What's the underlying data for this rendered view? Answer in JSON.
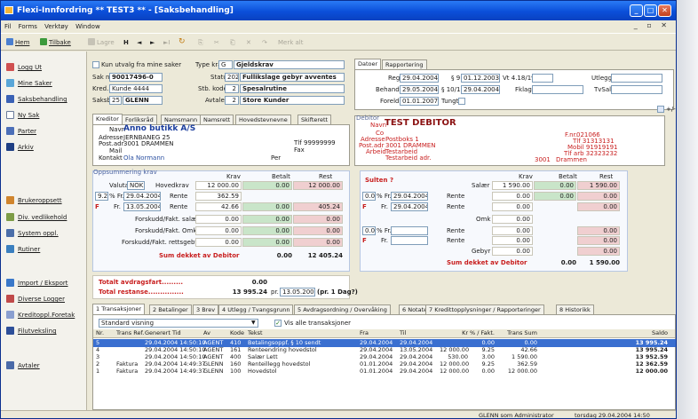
{
  "window": {
    "title": "Flexi-Innfordring ** TEST3 **   - [Saksbehandling]"
  },
  "menu": [
    "Fil",
    "Forms",
    "Verktøy",
    "Window"
  ],
  "toolbar": {
    "home": "Hem",
    "back": "Tilbake",
    "save": "Lagre",
    "first": "H",
    "prev": "◄",
    "next": "►",
    "last": "►I",
    "refresh": "↻",
    "copy": "⎘",
    "cut": "✂",
    "paste": "⎗",
    "delete": "✕",
    "redo": "↷",
    "report": "Merk alt"
  },
  "sidebar": {
    "items": [
      "Logg Ut",
      "Mine Saker",
      "Saksbehandling",
      "Ny Sak",
      "Parter",
      "Arkiv",
      "Brukeroppsett",
      "Div. vedlikehold",
      "System oppl.",
      "Rutiner",
      "Import / Eksport",
      "Diverse Logger",
      "Kreditoppl.Foretak",
      "Filutveksling",
      "Avtaler"
    ]
  },
  "case": {
    "only_mine_label": "Kun utvalg fra mine saker",
    "type_label": "Type krav",
    "type_code": "G",
    "type_name": "Gjeldskrav",
    "saknr_label": "Sak nr",
    "saknr": "90017496-0",
    "status_label": "Status",
    "status_code": "202",
    "status_text": "Fullikslage gebyr avventes",
    "kred_label": "Kred. ref.",
    "kred": "Kunde 4444",
    "stb_label": "Stb. kode",
    "stb_code": "2",
    "stb_text": "Spesalrutine",
    "saksbeh_label": "Saksbeh.",
    "saksbeh_code": "25",
    "saksbeh": "GLENN",
    "avtale_label": "Avtale",
    "avtale_code": "2",
    "avtale_text": "Store Kunder"
  },
  "dates": {
    "tabs": [
      "Datoer",
      "Rapportering"
    ],
    "reg_label": "Reg",
    "reg": "29.04.2004",
    "s9_label": "§ 9",
    "s9": "01.12.2003",
    "vt_label": "Vt 4.18/19",
    "utlegg_label": "Utlegg",
    "behand_label": "Behand",
    "behand": "29.05.2004",
    "s1011_label": "§ 10/11",
    "s1011": "29.04.2004",
    "fklage_label": "Fklage",
    "tvsalg_label": "TvSalg",
    "foreld_label": "Foreld",
    "foreld": "01.01.2007",
    "tungt_label": "Tungt"
  },
  "party_tabs": [
    "Kreditor",
    "Forliksråd",
    "Namsmann",
    "Namsrett",
    "Hovedstevnevne",
    "Skifterett"
  ],
  "creditor": {
    "navn_label": "Navn",
    "navn": "Anno butikk A/S",
    "adresse_label": "Adresse",
    "adresse": "JERNBANEG 25",
    "postadr_label": "Post.adr",
    "postadr": "3001  DRAMMEN",
    "mail_label": "Mail",
    "kontakt_label": "Kontakt",
    "kontakt": "Ola Normann",
    "tlf_label": "Tlf",
    "tlf": "99999999",
    "fax_label": "Fax",
    "per": "Per"
  },
  "debtor": {
    "header": "Debitor",
    "navn_label": "Navn",
    "navn": "TEST DEBITOR",
    "co_label": "Co",
    "adresse_label": "Adresse",
    "adresse": "Postboks 1",
    "postadr_label": "Post.adr",
    "postadr": "3001  DRAMMEN",
    "arbeid_label": "Arbeid",
    "arbeid": "Testarbeid",
    "arbeid_adr": "Testarbeid adr.",
    "fnr_label": "F.nr.",
    "fnr": "021066",
    "tlf": "Tlf 31313131",
    "mobil": "Mobil 91919191",
    "tlfarb": "Tlf arb 32323232",
    "postnr": "3001",
    "poststed": "Drammen",
    "pm": "+/-"
  },
  "summary_left": {
    "header": "Oppsummering krav",
    "col_krav": "Krav",
    "col_betalt": "Betalt",
    "col_rest": "Rest",
    "valuta_label": "Valuta",
    "valuta": "NOK",
    "hovedkrav_label": "Hovedkrav",
    "hovedkrav": [
      "12 000.00",
      "0.00",
      "12 000.00"
    ],
    "rente_pct": "9.25",
    "rente_from": "29.04.2004",
    "rente_label": "Rente",
    "rente": "362.59",
    "f_label": "F",
    "fra_label": "Fr.",
    "fra2": "13.05.2004",
    "rente2": [
      "42.66",
      "0.00",
      "405.24"
    ],
    "rows": [
      {
        "label": "Forskudd/Fakt. salær",
        "v": [
          "0.00",
          "0.00",
          "0.00"
        ]
      },
      {
        "label": "Forskudd/Fakt. Omk.",
        "v": [
          "0.00",
          "0.00",
          "0.00"
        ]
      },
      {
        "label": "Forskudd/Fakt. rettsgebyr",
        "v": [
          "0.00",
          "0.00",
          "0.00"
        ]
      }
    ],
    "sum_label": "Sum dekket av Debitor",
    "sum_betalt": "0.00",
    "sum_rest": "12 405.24",
    "avdrag_label": "Totalt avdragsfart.........",
    "avdrag": "0.00",
    "total_label": "Total restanse...............",
    "total": "13 995.24",
    "pr_label": "pr.",
    "pr_date": "13.05.2004",
    "pr_note": "(pr. 1 Dag?)"
  },
  "summary_right": {
    "header": "Sulten ?",
    "col_krav": "Krav",
    "col_betalt": "Betalt",
    "col_rest": "Rest",
    "salar_label": "Salær",
    "salar": [
      "1 590.00",
      "0.00",
      "1 590.00"
    ],
    "r1_pct": "0.00",
    "r1_date": "29.04.2004",
    "r1_label": "Rente",
    "r1": [
      "0.00",
      "0.00",
      "0.00"
    ],
    "r2_date": "29.04.2004",
    "r2_label": "Rente",
    "r2": [
      "0.00",
      "0.00"
    ],
    "omk_label": "Omk",
    "omk": "0.00",
    "r3_pct": "0.00",
    "r3_label": "Rente",
    "r3": [
      "0.00",
      "0.00"
    ],
    "r4_label": "Rente",
    "r4": [
      "0.00",
      "0.00"
    ],
    "gebyr_label": "Gebyr",
    "gebyr": [
      "0.00",
      "0.00"
    ],
    "sum_label": "Sum dekket av Debitor",
    "sum_betalt": "0.00",
    "sum_rest": "1 590.00"
  },
  "bottom_tabs": [
    "1 Transaksjoner",
    "2 Betalinger",
    "3 Brev",
    "4 Utlegg / Tvangsgrunn",
    "5 Avdragsordning / Overvåking",
    "6 Notater",
    "7 Kredittopplysninger / Rapporteringer",
    "8 Historikk"
  ],
  "grid": {
    "view": "Standard visning",
    "show_all": "Vis alle transaksjoner",
    "columns": [
      "Nr.",
      "Trans Ref.",
      "Generert Tid",
      "Av",
      "Kode",
      "Tekst",
      "Fra",
      "Til",
      "Kr",
      "% / Fakt.",
      "Trans Sum",
      "Saldo"
    ],
    "rows": [
      [
        "5",
        "",
        "29.04.2004 14:50:10",
        "AGENT",
        "410",
        "Betalingsoppf. § 10 sendt",
        "29.04.2004",
        "29.04.2004",
        "",
        "0.00",
        "0.00",
        "13 995.24"
      ],
      [
        "4",
        "",
        "29.04.2004 14:50:10",
        "AGENT",
        "161",
        "Renteendring hovedstol",
        "29.04.2004",
        "13.05.2004",
        "12 000.00",
        "9.25",
        "42.66",
        "13 995.24"
      ],
      [
        "3",
        "",
        "29.04.2004 14:50:10",
        "AGENT",
        "400",
        "Salær Lett",
        "29.04.2004",
        "29.04.2004",
        "530.00",
        "3.00",
        "1 590.00",
        "13 952.59"
      ],
      [
        "2",
        "Faktura",
        "29.04.2004 14:49:37",
        "GLENN",
        "160",
        "Renteillegg hovedstol",
        "01.01.2004",
        "29.04.2004",
        "12 000.00",
        "9.25",
        "362.59",
        "12 362.59"
      ],
      [
        "1",
        "Faktura",
        "29.04.2004 14:49:37",
        "GLENN",
        "100",
        "Hovedstol",
        "01.01.2004",
        "29.04.2004",
        "12 000.00",
        "0.00",
        "12 000.00",
        "12 000.00"
      ]
    ]
  },
  "status": {
    "user": "GLENN som Administrator",
    "date": "torsdag 29.04.2004 14:50"
  }
}
